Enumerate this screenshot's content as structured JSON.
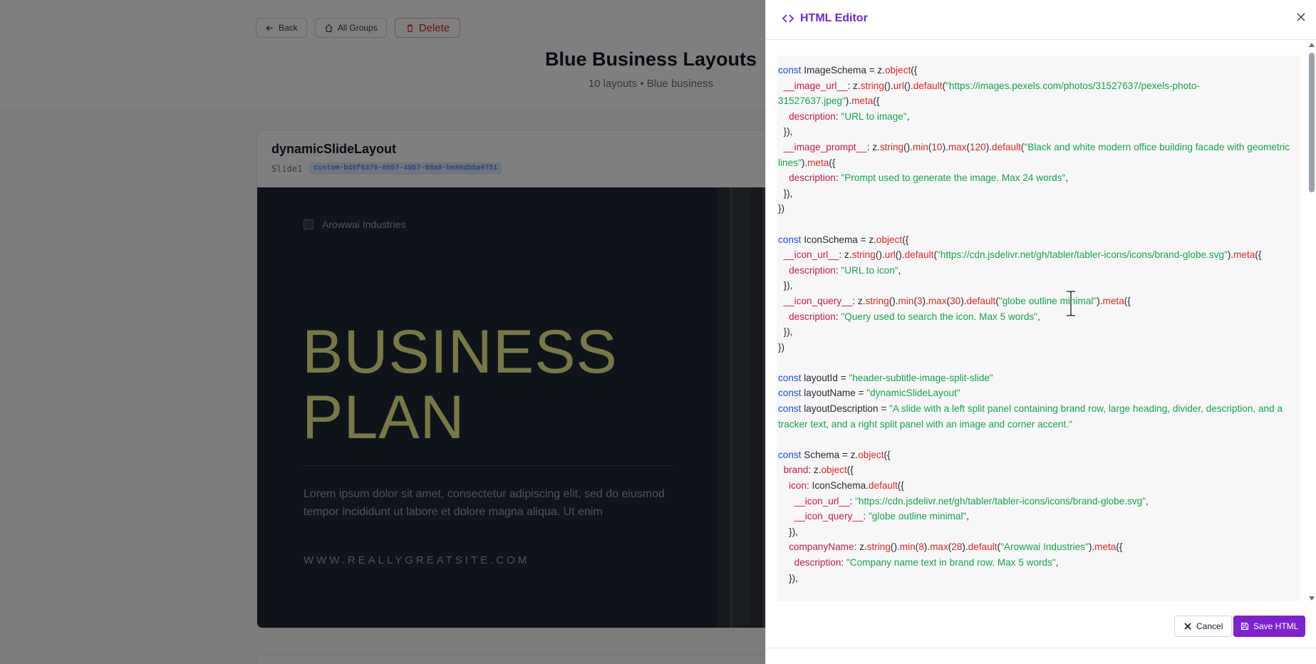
{
  "page": {
    "back_label": "Back",
    "all_groups_label": "All Groups",
    "delete_label": "Delete",
    "title": "Blue Business Layouts",
    "subtitle": "10 layouts • Blue business"
  },
  "layout_card": {
    "name": "dynamicSlideLayout",
    "slide_label": "Slide1",
    "id": "custom-b46f6379-8557-4957-88a8-be80d55a0751",
    "slide": {
      "brand": "Arowwai Industries",
      "heading_line1": "BUSINESS",
      "heading_line2": "PLAN",
      "description": "Lorem ipsum dolor sit amet, consectetur adipiscing elit, sed do eiusmod tempor incididunt ut labore et dolore magna aliqua. Ut enim",
      "tracker": "WWW.REALLYGREATSITE.COM"
    }
  },
  "editor": {
    "title": "HTML Editor",
    "cancel_label": "Cancel",
    "save_label": "Save HTML",
    "accent_color": "#7e22ce"
  }
}
